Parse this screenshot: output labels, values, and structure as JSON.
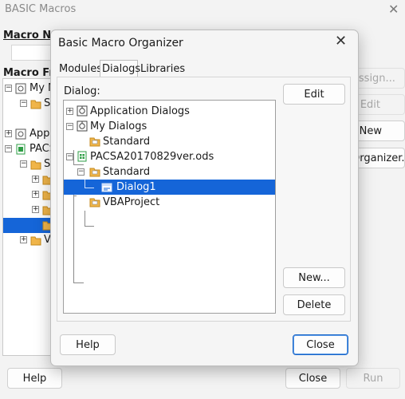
{
  "background_window": {
    "title": "BASIC Macros",
    "macro_name_label": "Macro Na",
    "macro_from_label": "Macro Fro",
    "tree_items": [
      "My M",
      "S",
      "",
      "Appl",
      "PACS",
      "S",
      "",
      "",
      "",
      "",
      "V"
    ],
    "buttons": {
      "assign": "Assign...",
      "edit": "Edit",
      "new": "New",
      "organizer": "Organizer...",
      "help": "Help",
      "close": "Close",
      "run": "Run"
    }
  },
  "dialog": {
    "title": "Basic Macro Organizer",
    "tabs": [
      "Modules",
      "Dialogs",
      "Libraries"
    ],
    "active_tab": "Dialogs",
    "dialog_label": "Dialog:",
    "tree": [
      {
        "label": "Application Dialogs",
        "icon": "library-icon",
        "level": 0,
        "expander": "+"
      },
      {
        "label": "My Dialogs",
        "icon": "library-icon",
        "level": 0,
        "expander": "-"
      },
      {
        "label": "Standard",
        "icon": "folder-icon",
        "level": 1,
        "expander": ""
      },
      {
        "label": "PACSA20170829ver.ods",
        "icon": "spreadsheet-icon",
        "level": 0,
        "expander": "-"
      },
      {
        "label": "Standard",
        "icon": "folder-icon",
        "level": 1,
        "expander": "-"
      },
      {
        "label": "Dialog1",
        "icon": "dialog-icon",
        "level": 2,
        "expander": "",
        "selected": true
      },
      {
        "label": "VBAProject",
        "icon": "folder-icon",
        "level": 1,
        "expander": ""
      }
    ],
    "buttons": {
      "edit": "Edit",
      "new": "New...",
      "delete": "Delete",
      "help": "Help",
      "close": "Close"
    }
  },
  "colors": {
    "selection": "#1565d8",
    "folder": "#f1b64a",
    "spreadsheet": "#2e9e45"
  }
}
